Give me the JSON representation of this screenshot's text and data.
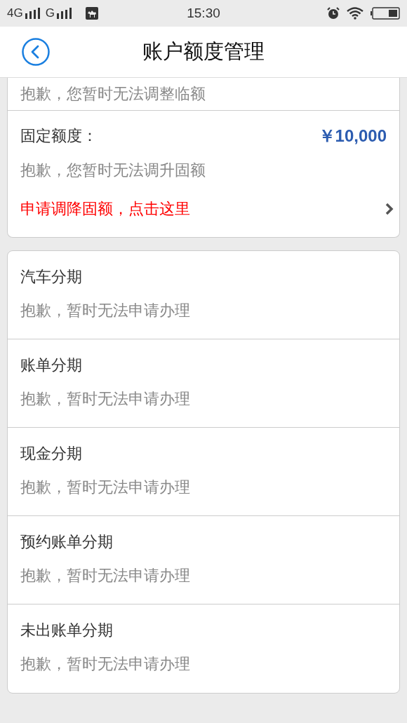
{
  "status_bar": {
    "network_1": "4G",
    "network_2": "G",
    "time": "15:30"
  },
  "header": {
    "title": "账户额度管理"
  },
  "temporary_limit": {
    "message": "抱歉，您暂时无法调整临额"
  },
  "fixed_limit": {
    "label": "固定额度：",
    "amount": "￥10,000",
    "message": "抱歉，您暂时无法调升固额",
    "link": "申请调降固额，点击这里"
  },
  "installments": [
    {
      "title": "汽车分期",
      "message": "抱歉，暂时无法申请办理"
    },
    {
      "title": "账单分期",
      "message": "抱歉，暂时无法申请办理"
    },
    {
      "title": "现金分期",
      "message": "抱歉，暂时无法申请办理"
    },
    {
      "title": "预约账单分期",
      "message": "抱歉，暂时无法申请办理"
    },
    {
      "title": "未出账单分期",
      "message": "抱歉，暂时无法申请办理"
    }
  ]
}
